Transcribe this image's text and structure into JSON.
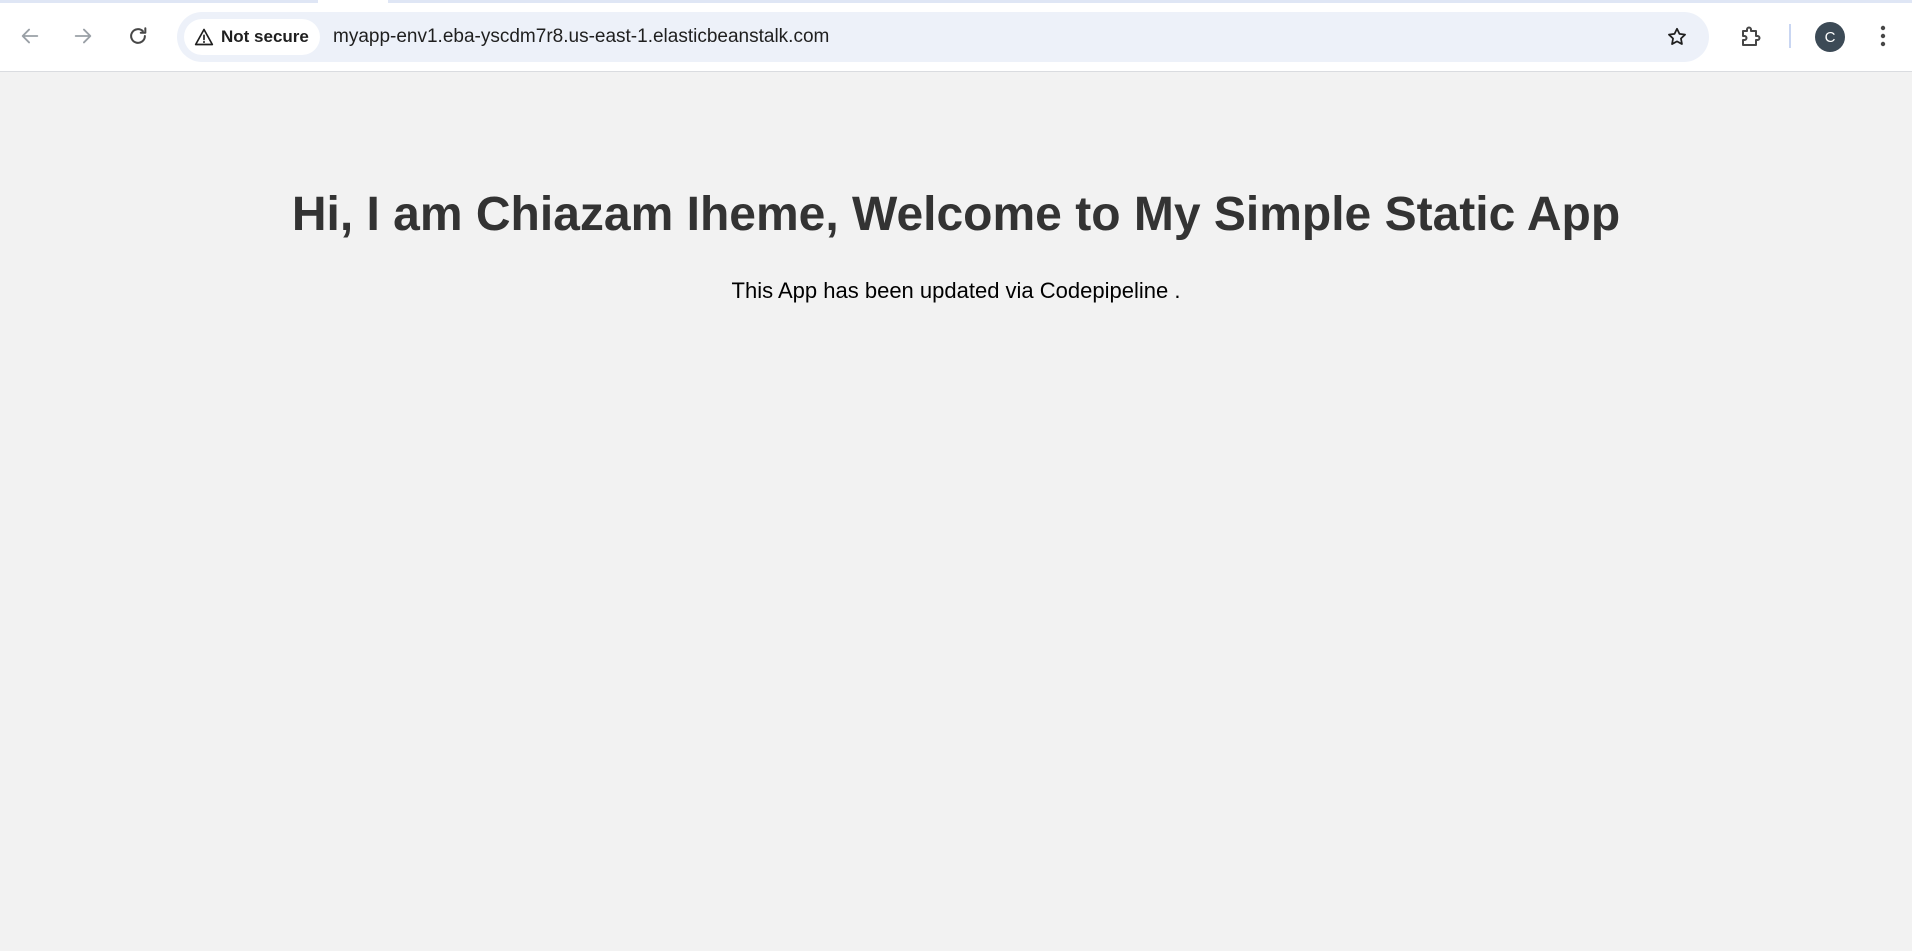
{
  "browser": {
    "security_label": "Not secure",
    "url": "myapp-env1.eba-yscdm7r8.us-east-1.elasticbeanstalk.com",
    "profile_initial": "C",
    "icons": {
      "back": "arrow-left-icon",
      "forward": "arrow-right-icon",
      "reload": "reload-icon",
      "warning": "warning-triangle-icon",
      "bookmark": "star-icon",
      "extensions": "puzzle-piece-icon",
      "menu": "kebab-menu-icon"
    },
    "colors": {
      "toolbar_bg": "#ffffff",
      "omnibox_bg": "#edf1f9",
      "avatar_bg": "#3c4a56"
    }
  },
  "page": {
    "heading": "Hi, I am Chiazam Iheme, Welcome to My Simple Static App",
    "subheading": "This App has been updated via Codepipeline .",
    "colors": {
      "background": "#f2f2f2",
      "heading": "#333333",
      "subheading": "#000000"
    }
  }
}
